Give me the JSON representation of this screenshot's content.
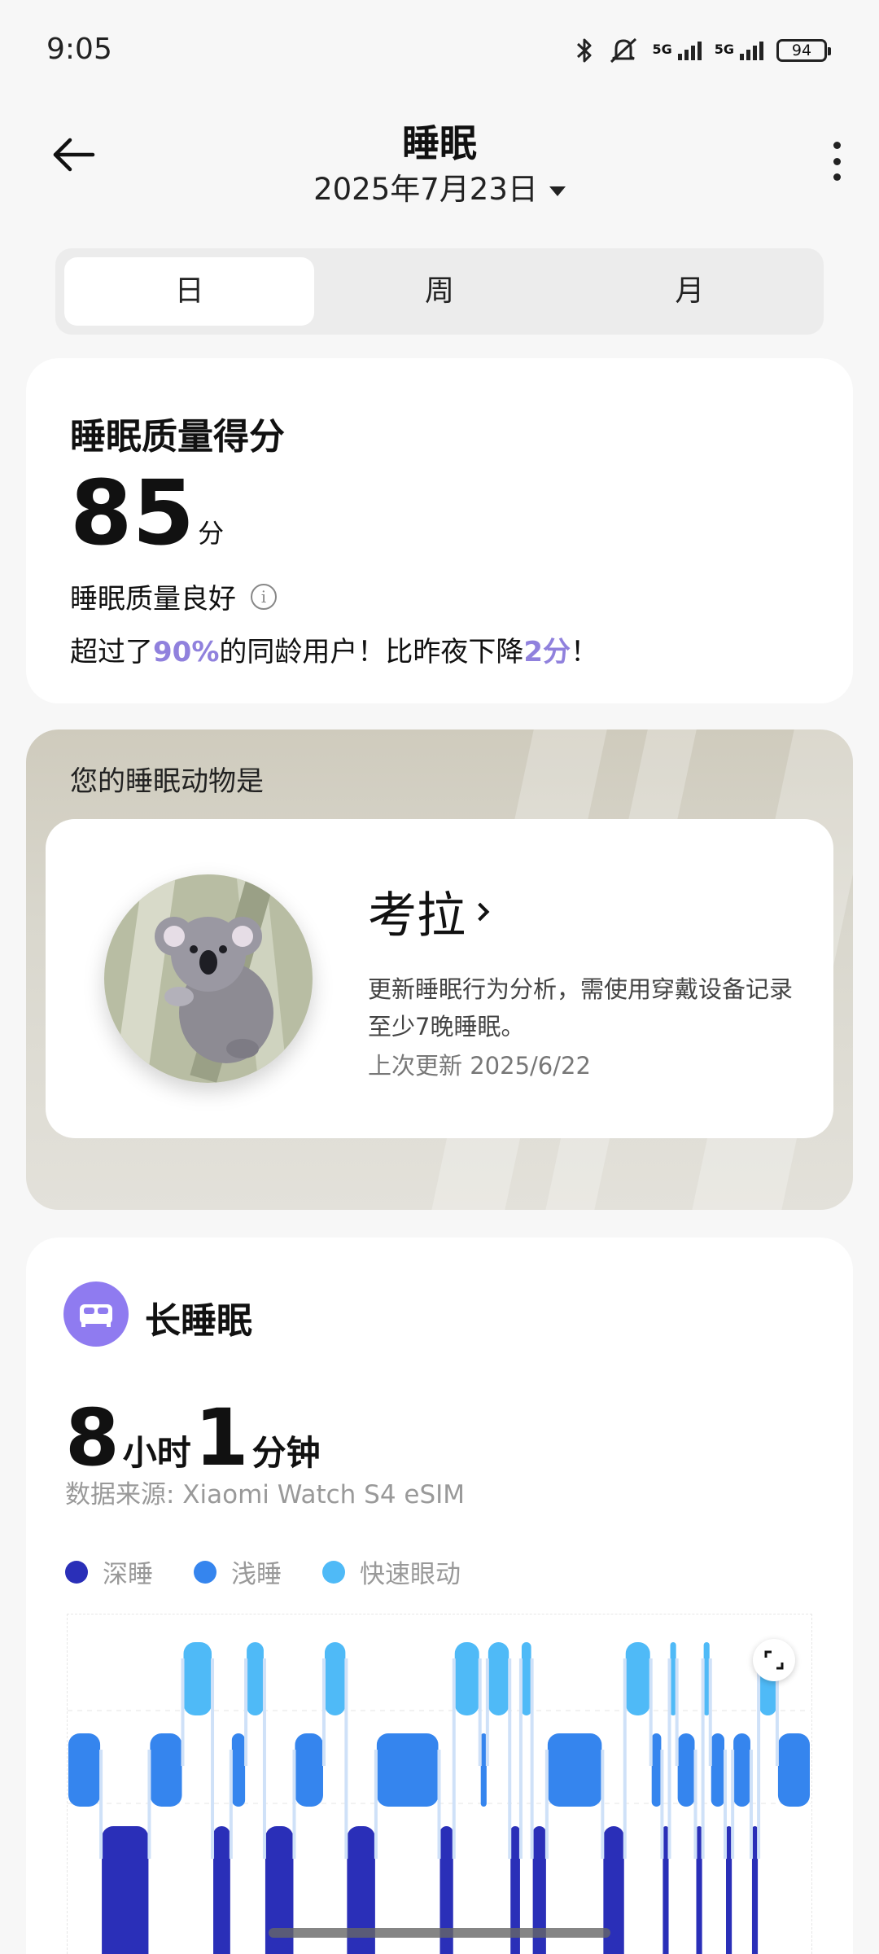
{
  "status_bar": {
    "time": "9:05",
    "battery": "94",
    "icons": [
      "bluetooth-icon",
      "mute-icon",
      "signal-5g-icon",
      "signal-5g-icon"
    ],
    "network_label": "5G"
  },
  "header": {
    "title": "睡眠",
    "date": "2025年7月23日"
  },
  "tabs": [
    {
      "label": "日",
      "active": true
    },
    {
      "label": "周",
      "active": false
    },
    {
      "label": "月",
      "active": false
    }
  ],
  "score": {
    "title": "睡眠质量得分",
    "value": "85",
    "unit": "分",
    "quality": "睡眠质量良好",
    "compare_pre": "超过了",
    "compare_pct": "90%",
    "compare_mid": "的同龄用户！比昨夜下降",
    "compare_delta": "2分",
    "compare_end": "！"
  },
  "animal": {
    "label": "您的睡眠动物是",
    "name": "考拉",
    "description": "更新睡眠行为分析，需使用穿戴设备记录至少7晚睡眠。",
    "updated": "上次更新 2025/6/22"
  },
  "long_sleep": {
    "title": "长睡眠",
    "hours": "8",
    "hours_unit": "小时",
    "minutes": "1",
    "minutes_unit": "分钟",
    "source": "数据来源: Xiaomi Watch S4 eSIM",
    "legend": [
      {
        "label": "深睡",
        "color": "#2a2fb8"
      },
      {
        "label": "浅睡",
        "color": "#3585ee"
      },
      {
        "label": "快速眼动",
        "color": "#4fbaf7"
      }
    ],
    "colors": {
      "deep": "#2a2fb8",
      "light": "#3585ee",
      "rem": "#4fbaf7",
      "accent": "#9081dd",
      "icon_bg": "#8f7bf0"
    }
  },
  "chart_data": {
    "type": "bar",
    "stage_levels": {
      "rem": 3,
      "light": 2,
      "deep": 1
    },
    "segments": [
      {
        "stage": "light",
        "start": 0.0,
        "end": 4.5
      },
      {
        "stage": "deep",
        "start": 4.5,
        "end": 11.0
      },
      {
        "stage": "light",
        "start": 11.0,
        "end": 15.5
      },
      {
        "stage": "rem",
        "start": 15.5,
        "end": 19.5
      },
      {
        "stage": "deep",
        "start": 19.5,
        "end": 22.0
      },
      {
        "stage": "light",
        "start": 22.0,
        "end": 24.0
      },
      {
        "stage": "rem",
        "start": 24.0,
        "end": 26.5
      },
      {
        "stage": "deep",
        "start": 26.5,
        "end": 30.5
      },
      {
        "stage": "light",
        "start": 30.5,
        "end": 34.5
      },
      {
        "stage": "rem",
        "start": 34.5,
        "end": 37.5
      },
      {
        "stage": "deep",
        "start": 37.5,
        "end": 41.5
      },
      {
        "stage": "light",
        "start": 41.5,
        "end": 50.0
      },
      {
        "stage": "deep",
        "start": 50.0,
        "end": 52.0
      },
      {
        "stage": "rem",
        "start": 52.0,
        "end": 55.5
      },
      {
        "stage": "light",
        "start": 55.5,
        "end": 56.5
      },
      {
        "stage": "rem",
        "start": 56.5,
        "end": 59.5
      },
      {
        "stage": "deep",
        "start": 59.5,
        "end": 61.0
      },
      {
        "stage": "rem",
        "start": 61.0,
        "end": 62.5
      },
      {
        "stage": "deep",
        "start": 62.5,
        "end": 64.5
      },
      {
        "stage": "light",
        "start": 64.5,
        "end": 72.0
      },
      {
        "stage": "deep",
        "start": 72.0,
        "end": 75.0
      },
      {
        "stage": "rem",
        "start": 75.0,
        "end": 78.5
      },
      {
        "stage": "light",
        "start": 78.5,
        "end": 80.0
      },
      {
        "stage": "deep",
        "start": 80.0,
        "end": 81.0
      },
      {
        "stage": "rem",
        "start": 81.0,
        "end": 82.0
      },
      {
        "stage": "light",
        "start": 82.0,
        "end": 84.5
      },
      {
        "stage": "deep",
        "start": 84.5,
        "end": 85.5
      },
      {
        "stage": "rem",
        "start": 85.5,
        "end": 86.5
      },
      {
        "stage": "light",
        "start": 86.5,
        "end": 88.5
      },
      {
        "stage": "deep",
        "start": 88.5,
        "end": 89.5
      },
      {
        "stage": "light",
        "start": 89.5,
        "end": 92.0
      },
      {
        "stage": "deep",
        "start": 92.0,
        "end": 93.0
      },
      {
        "stage": "rem",
        "start": 93.0,
        "end": 95.5
      },
      {
        "stage": "light",
        "start": 95.5,
        "end": 100.0
      }
    ]
  }
}
